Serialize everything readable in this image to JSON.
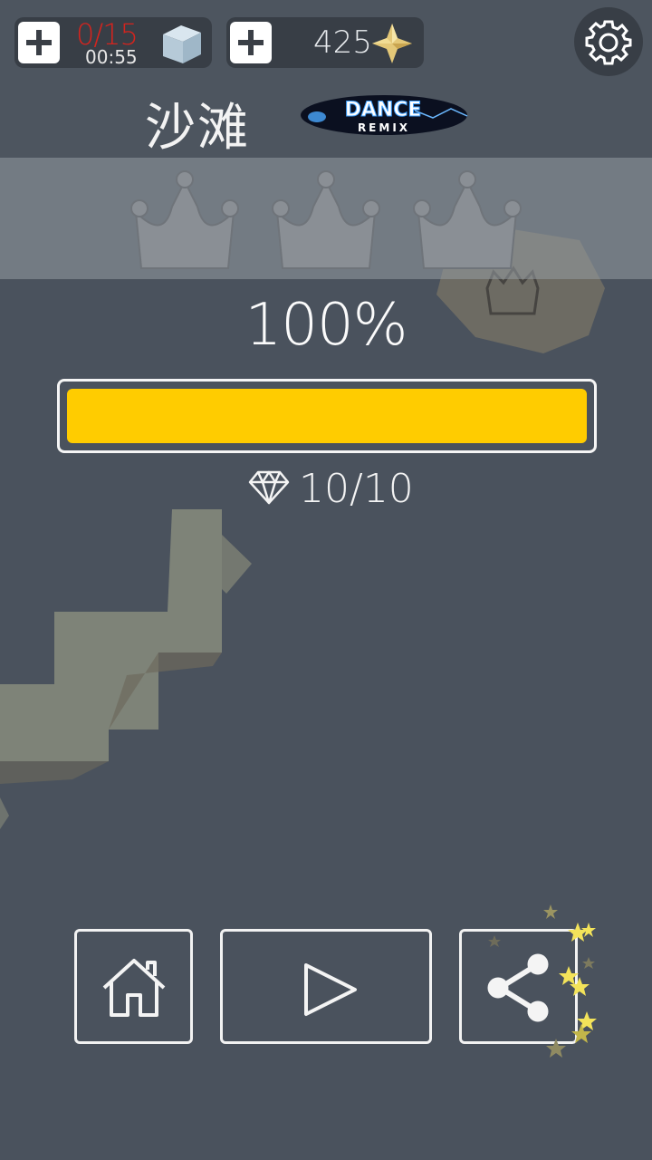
{
  "hud": {
    "cube_count": "0/15",
    "cube_timer": "00:55",
    "gem_count": "425"
  },
  "level": {
    "title": "沙滩",
    "badge_top": "DANCE",
    "badge_bottom": "REMIX",
    "crowns_earned": 0,
    "crowns_total": 3
  },
  "progress": {
    "percent_label": "100%",
    "fraction": 1.0,
    "diamonds_label": "10/10"
  },
  "colors": {
    "background": "#4a525d",
    "progress_fill": "#ffcc00",
    "cube_count_text": "#d4241e",
    "crown": "#8a8f95"
  },
  "icons": {
    "settings": "gear-icon",
    "home": "home-icon",
    "play": "play-icon",
    "share": "share-icon",
    "gem": "gold-gem-icon",
    "cube": "ice-cube-icon",
    "diamond": "diamond-icon"
  }
}
